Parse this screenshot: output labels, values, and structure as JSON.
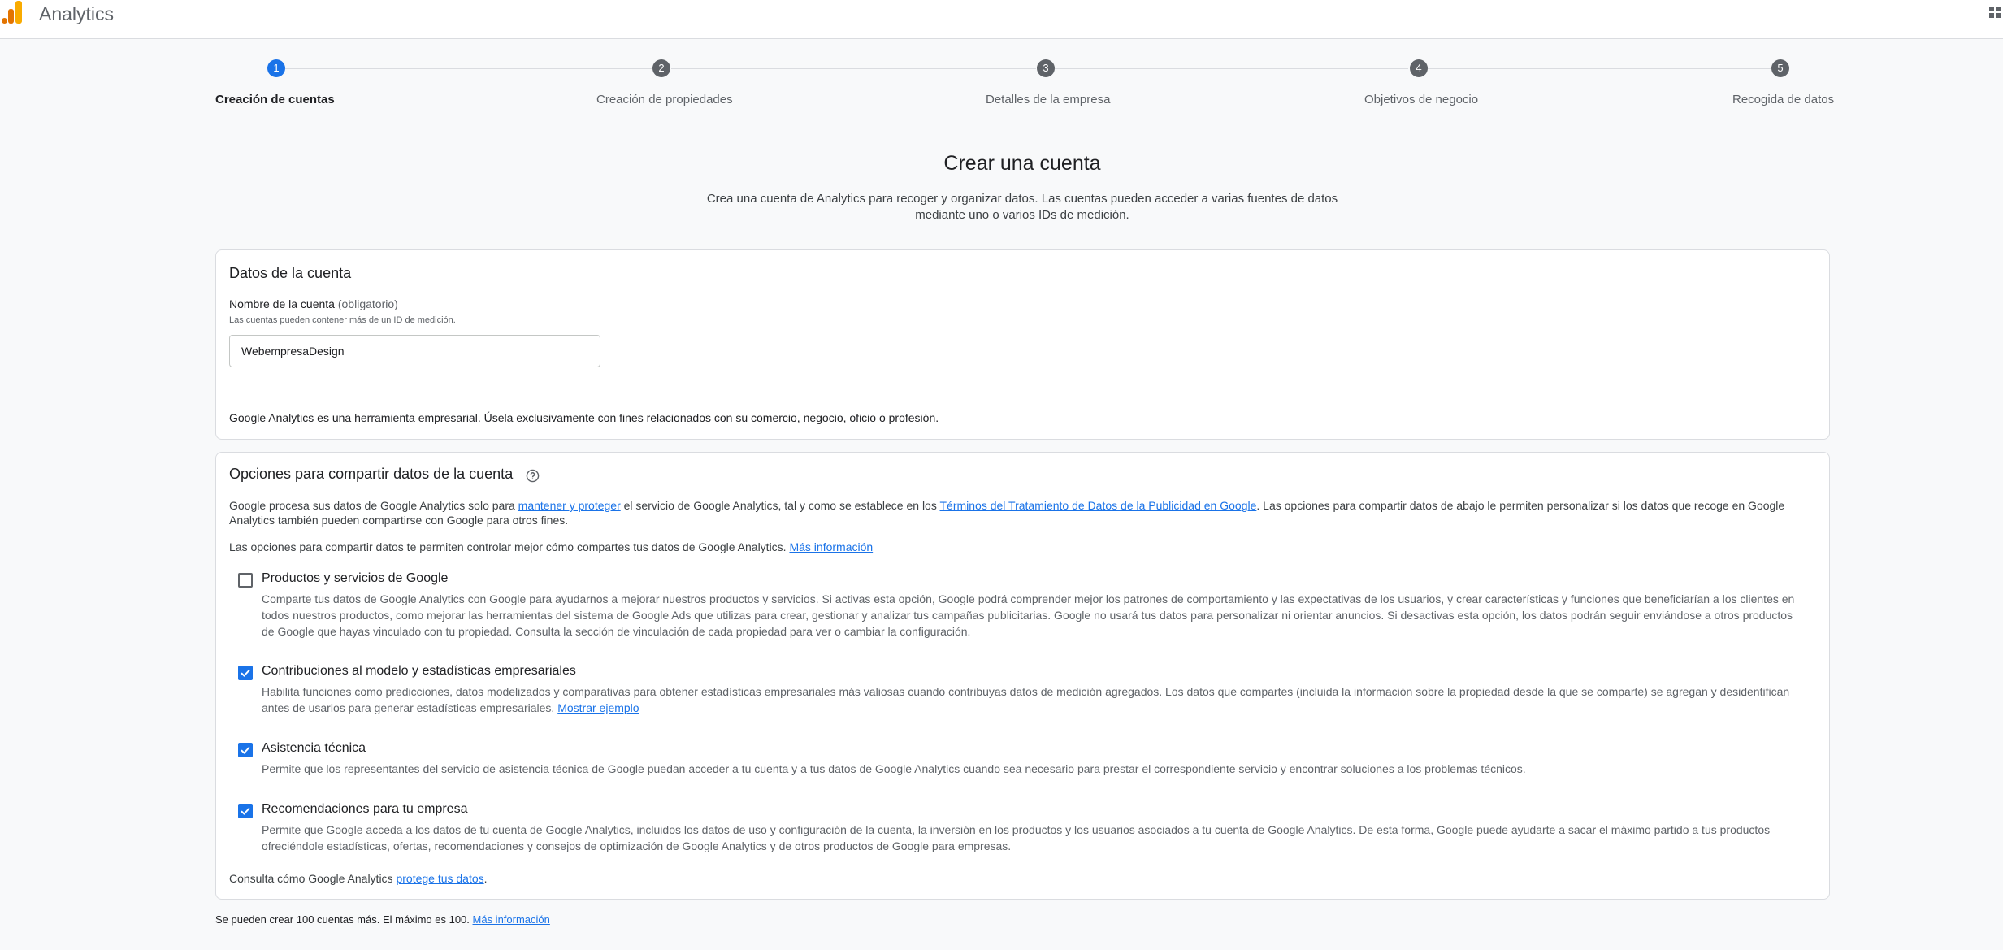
{
  "app": {
    "title": "Analytics",
    "brand_colors": [
      "#f9ab00",
      "#e37400"
    ]
  },
  "stepper": {
    "steps": [
      {
        "number": "1",
        "label": "Creación de cuentas",
        "active": true
      },
      {
        "number": "2",
        "label": "Creación de propiedades",
        "active": false
      },
      {
        "number": "3",
        "label": "Detalles de la empresa",
        "active": false
      },
      {
        "number": "4",
        "label": "Objetivos de negocio",
        "active": false
      },
      {
        "number": "5",
        "label": "Recogida de datos",
        "active": false
      }
    ]
  },
  "header": {
    "title": "Crear una cuenta",
    "description": "Crea una cuenta de Analytics para recoger y organizar datos. Las cuentas pueden acceder a varias fuentes de datos mediante uno o varios IDs de medición."
  },
  "account_details": {
    "title": "Datos de la cuenta",
    "name_label": "Nombre de la cuenta",
    "name_required": "(obligatorio)",
    "name_hint": "Las cuentas pueden contener más de un ID de medición.",
    "name_value": "WebempresaDesign",
    "business_note": "Google Analytics es una herramienta empresarial. Úsela exclusivamente con fines relacionados con su comercio, negocio, oficio o profesión."
  },
  "sharing": {
    "title": "Opciones para compartir datos de la cuenta",
    "intro_part1": "Google procesa sus datos de Google Analytics solo para ",
    "intro_link1": "mantener y proteger",
    "intro_part2": " el servicio de Google Analytics, tal y como se establece en los ",
    "intro_link2": "Términos del Tratamiento de Datos de la Publicidad en Google",
    "intro_part3": ". Las opciones para compartir datos de abajo le permiten personalizar si los datos que recoge en Google Analytics también pueden compartirse con Google para otros fines.",
    "control_text": "Las opciones para compartir datos te permiten controlar mejor cómo compartes tus datos de Google Analytics. ",
    "control_link": "Más información",
    "options": [
      {
        "title": "Productos y servicios de Google",
        "checked": false,
        "description": "Comparte tus datos de Google Analytics con Google para ayudarnos a mejorar nuestros productos y servicios. Si activas esta opción, Google podrá comprender mejor los patrones de comportamiento y las expectativas de los usuarios, y crear características y funciones que beneficiarían a los clientes en todos nuestros productos, como mejorar las herramientas del sistema de Google Ads que utilizas para crear, gestionar y analizar tus campañas publicitarias. Google no usará tus datos para personalizar ni orientar anuncios. Si desactivas esta opción, los datos podrán seguir enviándose a otros productos de Google que hayas vinculado con tu propiedad. Consulta la sección de vinculación de cada propiedad para ver o cambiar la configuración.",
        "link": ""
      },
      {
        "title": "Contribuciones al modelo y estadísticas empresariales",
        "checked": true,
        "description": "Habilita funciones como predicciones, datos modelizados y comparativas para obtener estadísticas empresariales más valiosas cuando contribuyas datos de medición agregados. Los datos que compartes (incluida la información sobre la propiedad desde la que se comparte) se agregan y desidentifican antes de usarlos para generar estadísticas empresariales. ",
        "link": "Mostrar ejemplo"
      },
      {
        "title": "Asistencia técnica",
        "checked": true,
        "description": "Permite que los representantes del servicio de asistencia técnica de Google puedan acceder a tu cuenta y a tus datos de Google Analytics cuando sea necesario para prestar el correspondiente servicio y encontrar soluciones a los problemas técnicos.",
        "link": ""
      },
      {
        "title": "Recomendaciones para tu empresa",
        "checked": true,
        "description": "Permite que Google acceda a los datos de tu cuenta de Google Analytics, incluidos los datos de uso y configuración de la cuenta, la inversión en los productos y los usuarios asociados a tu cuenta de Google Analytics. De esta forma, Google puede ayudarte a sacar el máximo partido a tus productos ofreciéndole estadísticas, ofertas, recomendaciones y consejos de optimización de Google Analytics y de otros productos de Google para empresas.",
        "link": ""
      }
    ],
    "protect_text": "Consulta cómo Google Analytics ",
    "protect_link": "protege tus datos",
    "protect_end": "."
  },
  "footer": {
    "text": "Se pueden crear 100 cuentas más. El máximo es 100. ",
    "link": "Más información"
  }
}
